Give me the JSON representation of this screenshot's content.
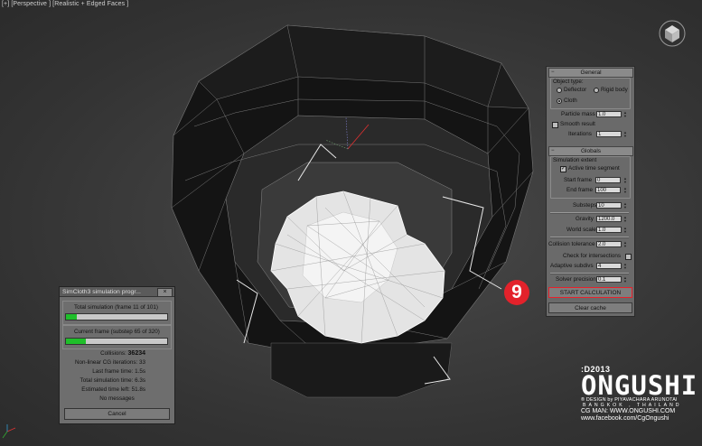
{
  "viewport": {
    "label": "[+] [Perspective ] [Realistic + Edged Faces ]"
  },
  "panel": {
    "general": {
      "title": "General",
      "minus": "−",
      "object_type_label": "Object type:",
      "deflector": "Deflector",
      "rigid_body": "Rigid body",
      "cloth": "Cloth",
      "particle_mass_label": "Particle mass",
      "particle_mass_value": "1.0",
      "smooth_result_label": "Smooth result",
      "iterations_label": "Iterations",
      "iterations_value": "1"
    },
    "globals": {
      "title": "Globals",
      "minus": "−",
      "simulation_extent_label": "Simulation extent",
      "active_time_segment_label": "Active time segment",
      "start_frame_label": "Start frame",
      "start_frame_value": "0",
      "end_frame_label": "End frame",
      "end_frame_value": "100",
      "substeps_label": "Substeps",
      "substeps_value": "10",
      "gravity_label": "Gravity",
      "gravity_value": "1200.0",
      "world_scale_label": "World scale",
      "world_scale_value": "1.0",
      "collision_tolerance_label": "Collision tolerance",
      "collision_tolerance_value": "2.0",
      "check_intersections_label": "Check for intersections",
      "adaptive_subdivs_label": "Adaptive subdivs",
      "adaptive_subdivs_value": "4",
      "solver_precision_label": "Solver precision",
      "solver_precision_value": "0.1"
    },
    "start_calculation": "START CALCULATION",
    "clear_cache": "Clear cache",
    "check": "✓"
  },
  "step_badge": "9",
  "dialog": {
    "title": "SimCloth3 simulation progr...",
    "close": "×",
    "total_simulation_label": "Total simulation (frame 11 of 101)",
    "total_progress": 0.11,
    "current_frame_label": "Current frame (substep 65 of 320)",
    "current_progress": 0.2,
    "collisions_label": "Collisions:",
    "collisions_value": "36234",
    "cg_iterations_label": "Non-linear CG iterations:",
    "cg_iterations_value": "33",
    "last_frame_time_label": "Last frame time:",
    "last_frame_time_value": "1.5s",
    "total_sim_time_label": "Total simulation time:",
    "total_sim_time_value": "6.3s",
    "estimated_time_label": "Estimated time left:",
    "estimated_time_value": "51.8s",
    "messages": "No messages",
    "cancel": "Cancel"
  },
  "logo": {
    "year": ":D2013",
    "name": "ONGUSHI",
    "credit": "® DESIGN by PIYAVACHARA ARUNOTAI",
    "location": "BANGKOK , THAILAND",
    "website": "CG MAN: WWW.ONGUSHI.COM",
    "facebook": "www.facebook.com/CgOngushi"
  },
  "colors": {
    "accent_red": "#e3222b",
    "progress_green": "#1fbf2a"
  }
}
